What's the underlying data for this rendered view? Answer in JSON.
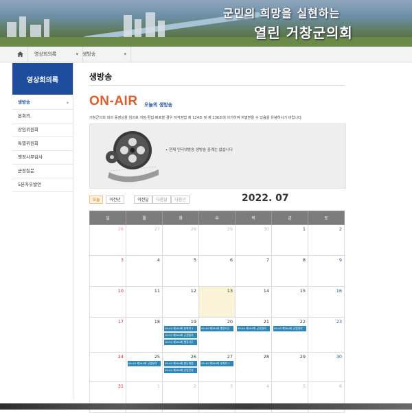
{
  "banner": {
    "slogan_line1": "군민의 희망을 실현하는",
    "slogan_line2": "열린 거창군의회"
  },
  "breadcrumb": {
    "home_icon": "home-icon",
    "items": [
      "영상회의록",
      "생방송"
    ]
  },
  "sidebar": {
    "title": "영상회의록",
    "items": [
      "생방송",
      "본회의",
      "상임위원회",
      "특별위원회",
      "행정사무감사",
      "군정질문",
      "5분자유발언"
    ]
  },
  "main": {
    "page_title": "생방송",
    "onair_title": "ON-AIR",
    "onair_subtitle": "오늘의 생방송",
    "notice": "거창군의회 회의 동영상을 임의로 저장·편집·배포할 경우 저작권법 제 124조 및 제 136조에 의거하여 처벌받을 수 있음을 유념하시기 바랍니다.",
    "player_message": "현재 인터넷방송 생방송 중계는 없습니다"
  },
  "calendar": {
    "buttons": [
      "오늘",
      "이전년",
      "이전달",
      "다음달",
      "다음년"
    ],
    "month_label": "2022. 07",
    "weekdays": [
      "일",
      "월",
      "화",
      "수",
      "목",
      "금",
      "토"
    ],
    "weeks": [
      [
        {
          "d": "26",
          "out": true
        },
        {
          "d": "27",
          "out": true
        },
        {
          "d": "28",
          "out": true
        },
        {
          "d": "29",
          "out": true
        },
        {
          "d": "30",
          "out": true
        },
        {
          "d": "1"
        },
        {
          "d": "2"
        }
      ],
      [
        {
          "d": "3"
        },
        {
          "d": "4"
        },
        {
          "d": "5"
        },
        {
          "d": "6"
        },
        {
          "d": "7"
        },
        {
          "d": "8"
        },
        {
          "d": "9"
        }
      ],
      [
        {
          "d": "10"
        },
        {
          "d": "11"
        },
        {
          "d": "12"
        },
        {
          "d": "13",
          "today": true
        },
        {
          "d": "14"
        },
        {
          "d": "15"
        },
        {
          "d": "16"
        }
      ],
      [
        {
          "d": "17"
        },
        {
          "d": "18"
        },
        {
          "d": "19",
          "events": [
            "09:40 제264회 본회의 1",
            "10:20 제264회 군정질의",
            "10:20 제264회 행정사무"
          ]
        },
        {
          "d": "20",
          "events": [
            "09:40 제264회 행정사무"
          ]
        },
        {
          "d": "21",
          "events": [
            "09:40 제264회 군정질의"
          ]
        },
        {
          "d": "22",
          "events": [
            "09:40 제264회 군정질의"
          ]
        },
        {
          "d": "23"
        }
      ],
      [
        {
          "d": "24"
        },
        {
          "d": "25",
          "events": [
            "09:40 제264회 군정질의"
          ]
        },
        {
          "d": "26",
          "events": [
            "09:40 제264회 총무위원",
            "09:40 제264회 산업건설"
          ]
        },
        {
          "d": "27",
          "events": [
            "09:40 제264회 본회의 2"
          ]
        },
        {
          "d": "28"
        },
        {
          "d": "29"
        },
        {
          "d": "30"
        }
      ],
      [
        {
          "d": "31"
        },
        {
          "d": "1",
          "out": true
        },
        {
          "d": "2",
          "out": true
        },
        {
          "d": "3",
          "out": true
        },
        {
          "d": "4",
          "out": true
        },
        {
          "d": "5",
          "out": true
        },
        {
          "d": "6",
          "out": true
        }
      ]
    ]
  },
  "colors": {
    "brand_blue": "#1f4d9e",
    "onair_orange": "#e25b2a",
    "event_blue": "#2f87b8",
    "today_bg": "#fbf3d7"
  }
}
